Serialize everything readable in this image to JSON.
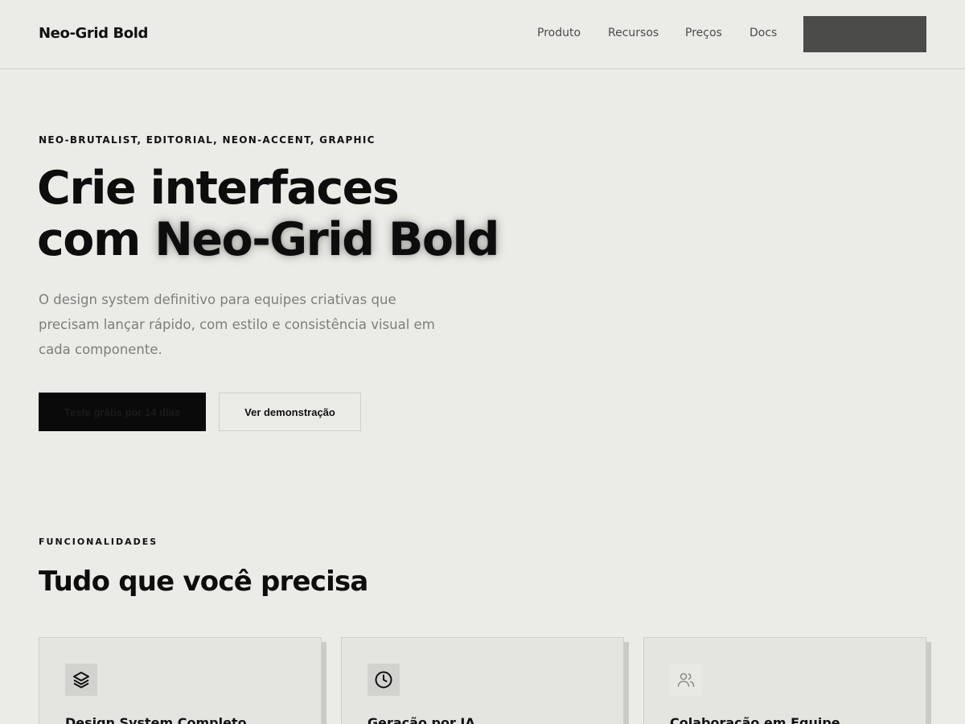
{
  "header": {
    "brand": "Neo-Grid Bold",
    "nav": [
      "Produto",
      "Recursos",
      "Preços",
      "Docs"
    ],
    "cta_label": ""
  },
  "hero": {
    "eyebrow": "NEO-BRUTALIST, EDITORIAL, NEON-ACCENT, GRAPHIC",
    "title_line1": "Crie interfaces",
    "title_line2_prefix": "com ",
    "title_line2_highlight": "Neo-Grid Bold",
    "subtitle": "O design system definitivo para equipes criativas que precisam lançar rápido, com estilo e consistência visual em cada componente.",
    "primary_button": "Teste grátis por 14 dias",
    "secondary_button": "Ver demonstração"
  },
  "features": {
    "eyebrow": "FUNCIONALIDADES",
    "title": "Tudo que você precisa",
    "cards": [
      {
        "title": "Design System Completo",
        "icon": "layers-icon"
      },
      {
        "title": "Geração por IA",
        "icon": "clock-icon"
      },
      {
        "title": "Colaboração em Equipe",
        "icon": "users-icon"
      }
    ]
  },
  "colors": {
    "background": "#ebebe7",
    "text": "#0f0f0f",
    "muted": "#7d7d7a",
    "primary_button": "#0a0a0a",
    "top_cta": "#4b4b49"
  }
}
